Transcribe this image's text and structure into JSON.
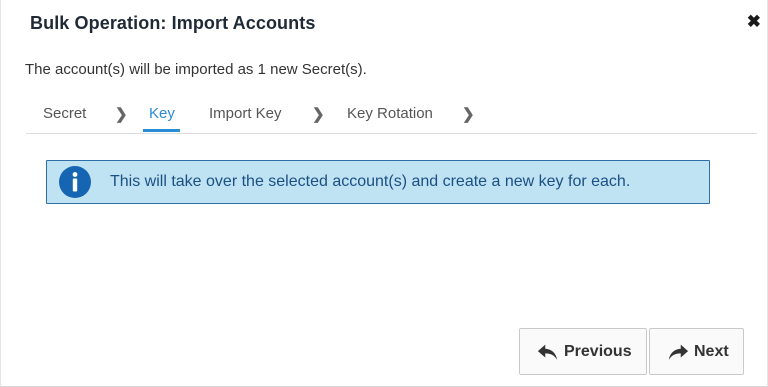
{
  "dialog": {
    "title": "Bulk Operation: Import Accounts",
    "close_symbol": "✖",
    "subtitle": "The account(s) will be imported as 1 new Secret(s)."
  },
  "steps": {
    "items": [
      {
        "label": "Secret",
        "active": false
      },
      {
        "label": "Key",
        "active": true
      },
      {
        "label": "Import Key",
        "active": false
      },
      {
        "label": "Key Rotation",
        "active": false
      }
    ],
    "separator": "❯"
  },
  "info": {
    "icon": "info-circle-icon",
    "message": "This will take over the selected account(s) and create a new key for each."
  },
  "buttons": {
    "previous_label": "Previous",
    "previous_icon": "reply-arrow-icon",
    "next_label": "Next",
    "next_icon": "forward-arrow-icon"
  },
  "colors": {
    "accent": "#2b8cd6",
    "info_background": "#bfe3f3",
    "info_border": "#2d6fa8",
    "info_icon": "#1565b3"
  }
}
